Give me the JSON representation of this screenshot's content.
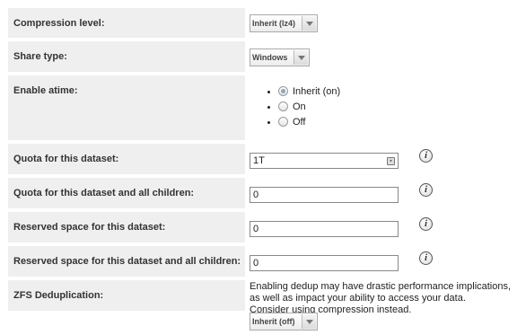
{
  "compression": {
    "label": "Compression level:",
    "value": "Inherit (lz4)"
  },
  "share_type": {
    "label": "Share type:",
    "value": "Windows"
  },
  "atime": {
    "label": "Enable atime:",
    "options": [
      {
        "text": "Inherit (on)",
        "selected": true
      },
      {
        "text": "On",
        "selected": false
      },
      {
        "text": "Off",
        "selected": false
      }
    ]
  },
  "quota": {
    "label": "Quota for this dataset:",
    "value": "1T"
  },
  "quota_children": {
    "label": "Quota for this dataset and all children:",
    "value": "0"
  },
  "reserved": {
    "label": "Reserved space for this dataset:",
    "value": "0"
  },
  "reserved_children": {
    "label": "Reserved space for this dataset and all children:",
    "value": "0"
  },
  "dedup": {
    "label": "ZFS Deduplication:",
    "note_lines": [
      "Enabling dedup may have drastic performance implications,",
      "as well as impact your ability to access your data.",
      "Consider using compression instead."
    ],
    "value": "Inherit (off)"
  },
  "info_icon_glyph": "i"
}
